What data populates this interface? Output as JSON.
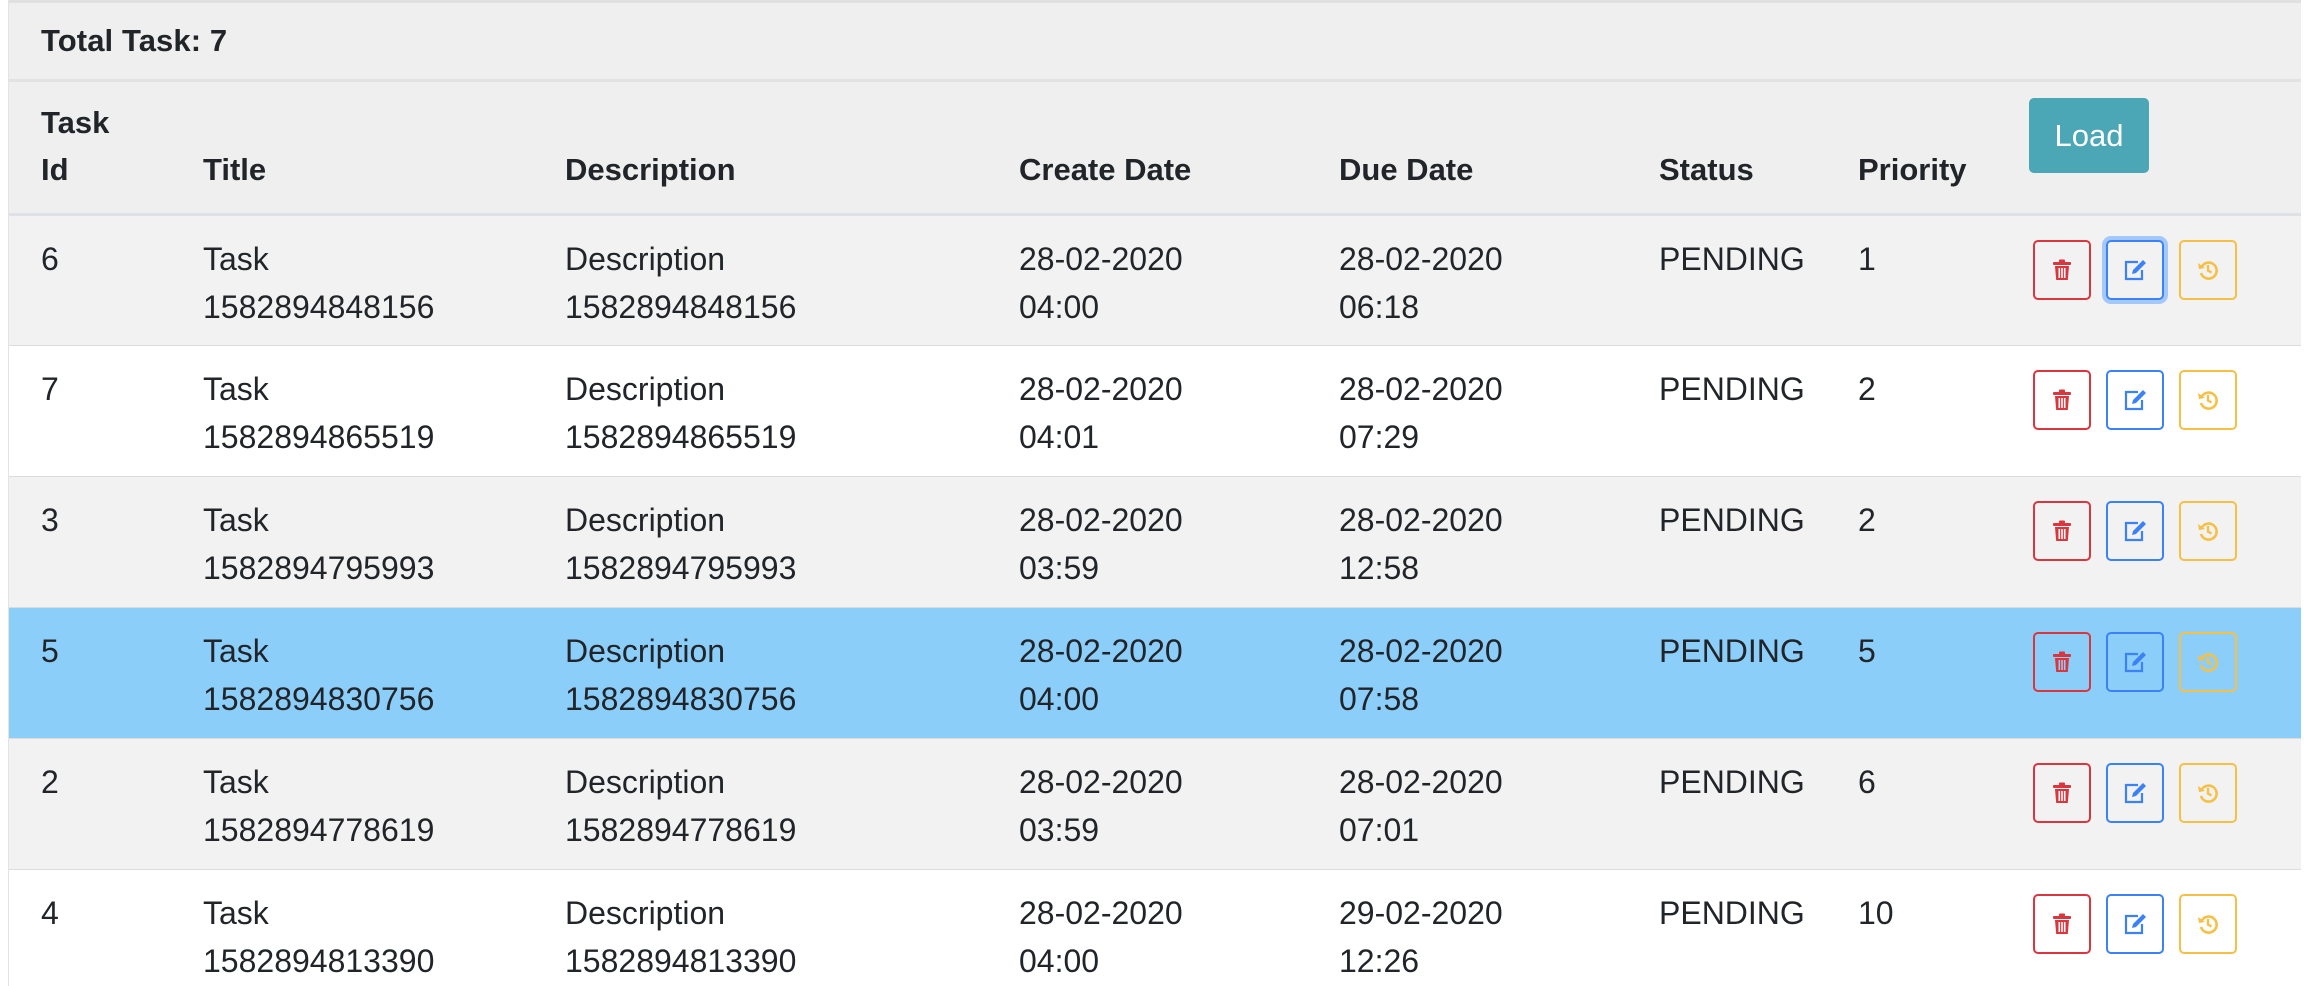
{
  "summary": {
    "total_label": "Total Task: 7"
  },
  "table": {
    "headers": {
      "task_id_line1": "Task",
      "task_id_line2": "Id",
      "title": "Title",
      "description": "Description",
      "create_date": "Create Date",
      "due_date": "Due Date",
      "status": "Status",
      "priority": "Priority",
      "load_button": "Load"
    },
    "rows": [
      {
        "id": "6",
        "title_1": "Task",
        "title_2": "1582894848156",
        "desc_1": "Description",
        "desc_2": "1582894848156",
        "create_1": "28-02-2020",
        "create_2": "04:00",
        "due_1": "28-02-2020",
        "due_2": "06:18",
        "status": "PENDING",
        "priority": "1"
      },
      {
        "id": "7",
        "title_1": "Task",
        "title_2": "1582894865519",
        "desc_1": "Description",
        "desc_2": "1582894865519",
        "create_1": "28-02-2020",
        "create_2": "04:01",
        "due_1": "28-02-2020",
        "due_2": "07:29",
        "status": "PENDING",
        "priority": "2"
      },
      {
        "id": "3",
        "title_1": "Task",
        "title_2": "1582894795993",
        "desc_1": "Description",
        "desc_2": "1582894795993",
        "create_1": "28-02-2020",
        "create_2": "03:59",
        "due_1": "28-02-2020",
        "due_2": "12:58",
        "status": "PENDING",
        "priority": "2"
      },
      {
        "id": "5",
        "title_1": "Task",
        "title_2": "1582894830756",
        "desc_1": "Description",
        "desc_2": "1582894830756",
        "create_1": "28-02-2020",
        "create_2": "04:00",
        "due_1": "28-02-2020",
        "due_2": "07:58",
        "status": "PENDING",
        "priority": "5"
      },
      {
        "id": "2",
        "title_1": "Task",
        "title_2": "1582894778619",
        "desc_1": "Description",
        "desc_2": "1582894778619",
        "create_1": "28-02-2020",
        "create_2": "03:59",
        "due_1": "28-02-2020",
        "due_2": "07:01",
        "status": "PENDING",
        "priority": "6"
      },
      {
        "id": "4",
        "title_1": "Task",
        "title_2": "1582894813390",
        "desc_1": "Description",
        "desc_2": "1582894813390",
        "create_1": "28-02-2020",
        "create_2": "04:00",
        "due_1": "29-02-2020",
        "due_2": "12:26",
        "status": "PENDING",
        "priority": "10"
      }
    ],
    "row_actions": {
      "delete_icon": "trash-icon",
      "edit_icon": "edit-icon",
      "history_icon": "history-icon"
    }
  },
  "colors": {
    "load_button": "#4ba6b5",
    "selected_row": "#8ccefa",
    "delete": "#d9363e",
    "edit": "#3b82f6",
    "history": "#f5c045"
  }
}
